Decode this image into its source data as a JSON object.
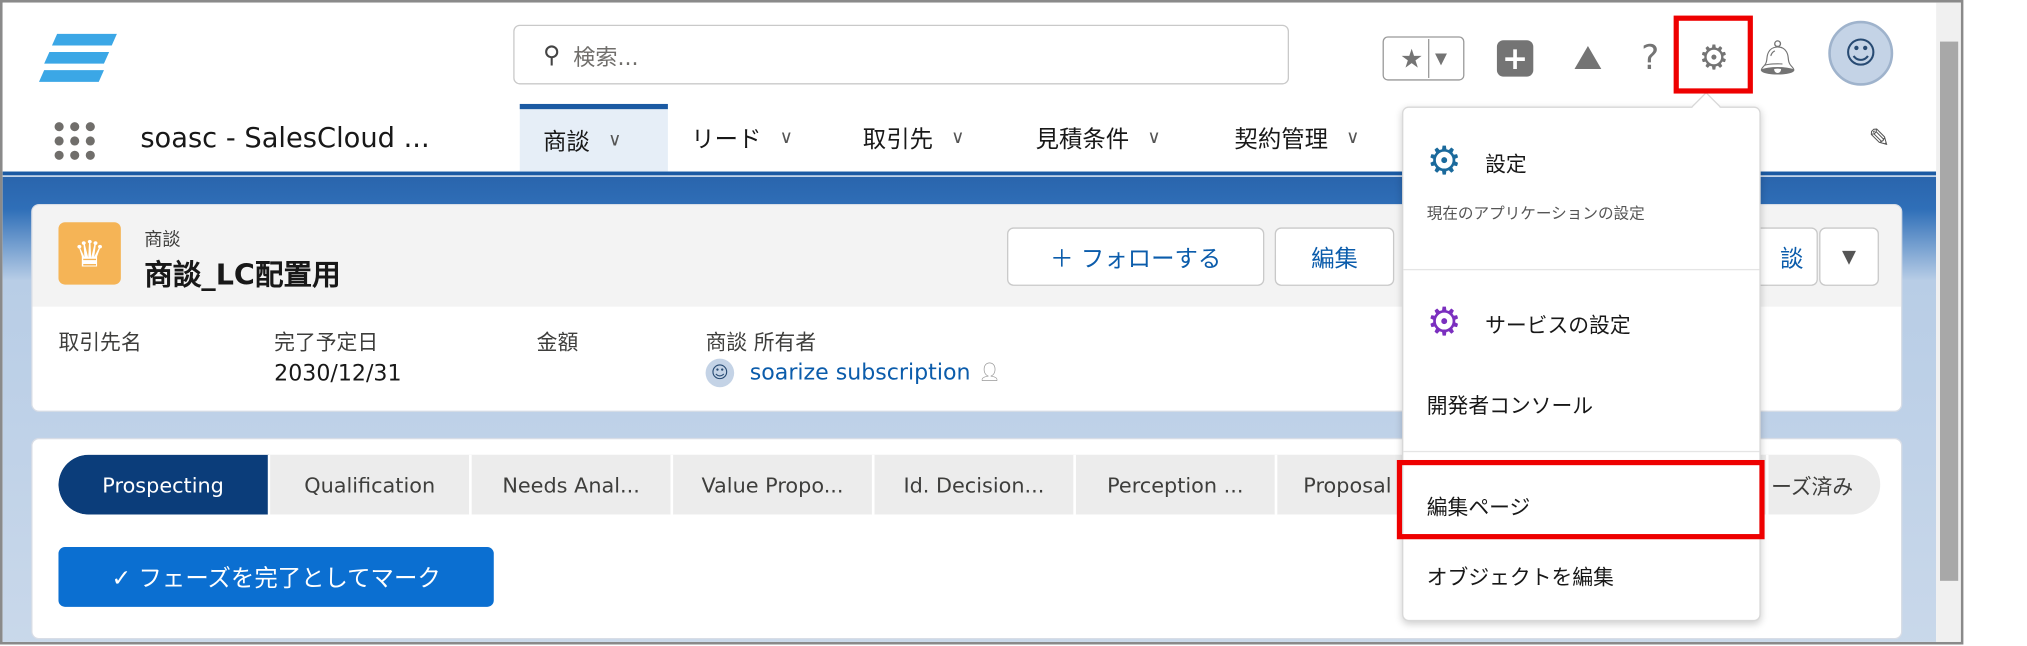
{
  "header": {
    "search_placeholder": "検索...",
    "icons": [
      "favorites-star-icon",
      "add-icon",
      "trailhead-icon",
      "help-icon",
      "setup-gear-icon",
      "notification-bell-icon",
      "avatar"
    ]
  },
  "nav": {
    "app_name": "soasc - SalesCloud ...",
    "tabs": [
      {
        "label": "商談",
        "active": true
      },
      {
        "label": "リード"
      },
      {
        "label": "取引先"
      },
      {
        "label": "見積条件"
      },
      {
        "label": "契約管理"
      }
    ]
  },
  "record": {
    "object_label": "商談",
    "title": "商談_LC配置用",
    "buttons": {
      "follow": "＋ フォローする",
      "edit": "編集",
      "partial": "談"
    },
    "fields": [
      {
        "label": "取引先名",
        "value": ""
      },
      {
        "label": "完了予定日",
        "value": "2030/12/31"
      },
      {
        "label": "金額",
        "value": ""
      },
      {
        "label": "商談 所有者",
        "value": "soarize subscription"
      }
    ]
  },
  "path": {
    "stages": [
      "Prospecting",
      "Qualification",
      "Needs Anal...",
      "Value Propo...",
      "Id. Decision...",
      "Perception ...",
      "Proposal",
      "ーズ済み"
    ],
    "current": "Prospecting",
    "complete_button": "✓ フェーズを完了としてマーク"
  },
  "setup_menu": {
    "setup": "設定",
    "setup_desc": "現在のアプリケーションの設定",
    "service_setup": "サービスの設定",
    "dev_console": "開発者コンソール",
    "edit_page": "編集ページ",
    "edit_object": "オブジェクトを編集"
  },
  "colors": {
    "brand": "#1b5aa3",
    "highlight": "#ee0000",
    "crown": "#f5b456",
    "service_gear": "#7b2fbf"
  }
}
